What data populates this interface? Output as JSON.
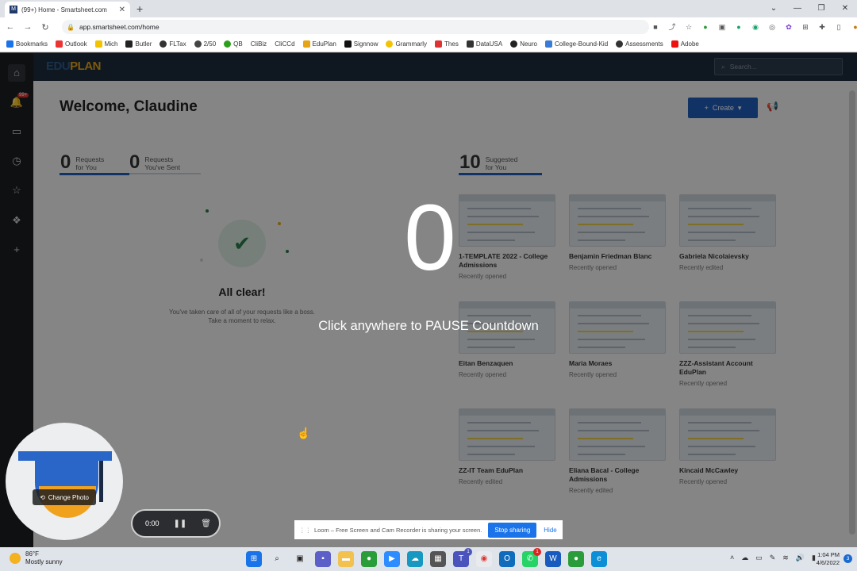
{
  "browser": {
    "tab_title": "(99+) Home - Smartsheet.com",
    "url": "app.smartsheet.com/home",
    "bookmarks": [
      "Bookmarks",
      "Outlook",
      "Mich",
      "Butler",
      "FLTax",
      "2/50",
      "QB",
      "CliBiz",
      "CliCCd",
      "EduPlan",
      "Signnow",
      "Grammarly",
      "Thes",
      "DataUSA",
      "Neuro",
      "College-Bound-Kid",
      "Assessments",
      "Adobe"
    ]
  },
  "app": {
    "logo_primary": "EDU",
    "logo_secondary": "PLAN",
    "notification_badge": "99+",
    "search_placeholder": "Search...",
    "welcome": "Welcome, Claudine",
    "create_label": "Create",
    "requests_for_you": {
      "count": "0",
      "label_line1": "Requests",
      "label_line2": "for You"
    },
    "requests_sent": {
      "count": "0",
      "label_line1": "Requests",
      "label_line2": "You've Sent"
    },
    "suggested": {
      "count": "10",
      "label_line1": "Suggested",
      "label_line2": "for You"
    },
    "all_clear_title": "All clear!",
    "all_clear_sub": "You've taken care of all of your requests like a boss. Take a moment to relax.",
    "cards": [
      {
        "title": "1-TEMPLATE 2022 - College Admissions",
        "sub": "Recently opened"
      },
      {
        "title": "Benjamin Friedman Blanc",
        "sub": "Recently opened"
      },
      {
        "title": "Gabriela Nicolaievsky",
        "sub": "Recently edited"
      },
      {
        "title": "Eitan Benzaquen",
        "sub": "Recently opened"
      },
      {
        "title": "Maria Moraes",
        "sub": "Recently opened"
      },
      {
        "title": "ZZZ-Assistant Account EduPlan",
        "sub": "Recently opened"
      },
      {
        "title": "ZZ-IT Team EduPlan",
        "sub": "Recently edited"
      },
      {
        "title": "Eliana Bacal - College Admissions",
        "sub": "Recently edited"
      },
      {
        "title": "Kincaid McCawley",
        "sub": "Recently opened"
      }
    ]
  },
  "recorder": {
    "countdown": "0",
    "pause_message": "Click anywhere to PAUSE Countdown",
    "change_photo": "Change Photo",
    "timer": "0:00",
    "share_text": "Loom – Free Screen and Cam Recorder is sharing your screen.",
    "stop_sharing": "Stop sharing",
    "hide": "Hide"
  },
  "taskbar": {
    "temperature": "86°F",
    "condition": "Mostly sunny",
    "time": "1:04 PM",
    "date": "4/6/2022",
    "notification_count": "3",
    "teams_badge": "1"
  },
  "colors": {
    "accent": "#1f5bb8",
    "header_bg": "#1d2b3c",
    "rail_bg": "#1b1e22"
  }
}
